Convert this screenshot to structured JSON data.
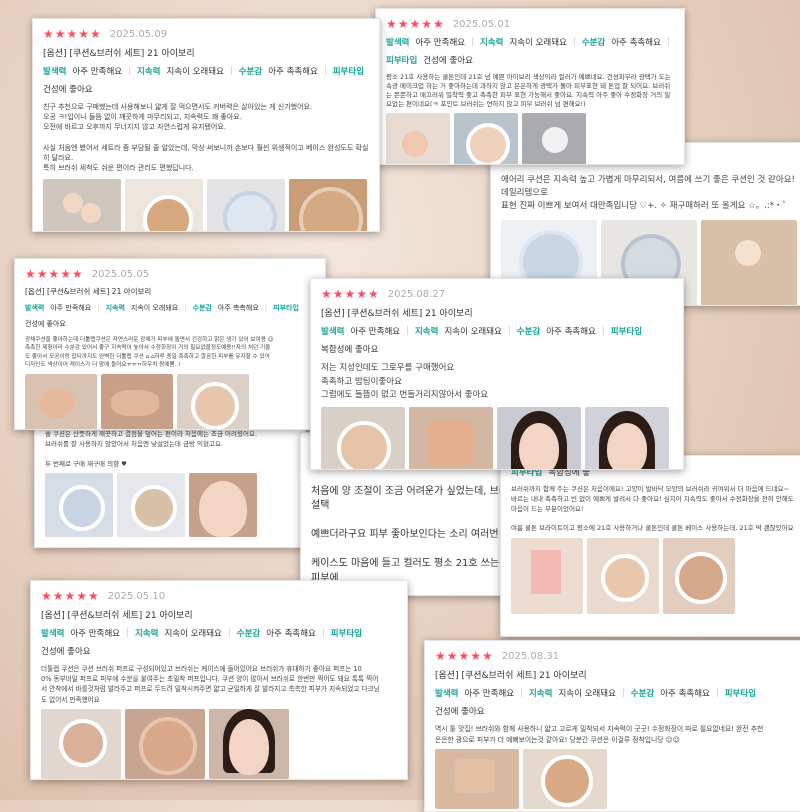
{
  "colors": {
    "star": "#ff4d5e",
    "attr_label": "#1aa39a",
    "text": "#444444",
    "date": "#aaaaaa"
  },
  "rating_stars": "★★★★★",
  "cards": {
    "c1": {
      "date": "2025.05.09",
      "option": "[옵션] [쿠션&브러쉬 세트] 21 아이보리",
      "attrs": [
        {
          "k": "발색력",
          "v": "아주 만족해요"
        },
        {
          "k": "지속력",
          "v": "지속이 오래돼요"
        },
        {
          "k": "수분감",
          "v": "아주 촉촉해요"
        },
        {
          "k": "피부타입",
          "v": "건성에 좋아요"
        }
      ],
      "body": "친구 추천으로 구매했는데 사용해보니 얇게 잘 먹으면서도 커버력은 살아있는 게 신기했어요.\n오공 ㅋ!입이나 들뜸 없이 깨끗하게 마무리되고, 지속력도 꽤 좋아요.\n오전에 바르고 오후까지 무너지지 않고 자연스럽게 유지됐어요.\n\n사실 처음엔 봤어서 세트라 좀 부담될 줄 알았는데, 막상 써보니까 손보다 훨씬 위생적이고 베이스 완성도도 확실히 달라요.\n특히 브러쉬 세척도 쉬운 편이라 관리도 편했답니다."
    },
    "c2": {
      "date": "2025.05.01",
      "attrs": [
        {
          "k": "발색력",
          "v": "아주 만족해요"
        },
        {
          "k": "지속력",
          "v": "지속이 오래돼요"
        },
        {
          "k": "수분감",
          "v": "아주 촉촉해요"
        },
        {
          "k": "피부타입",
          "v": "건성에 좋아요"
        }
      ],
      "body": "평소 21호 사용하는 쿨톤인데 21호 넘 예쁜 아이보리 색상이라 컬러가 예쁘네요. 건성피부라 광택가 도는 속광 메이크업 하는 거 좋아하는데 과하지 않고 은은하게 광택가 돌아 피부표현 돼 톤업 잘 되어요. 브러쉬는 쫀쫀하고 매끄러워 밀착력 좋고 촉촉한 피부 표현 가능해서 좋아요. 지속력 아주 좋아 수정화장 거의 필요없는 편이네요(ㅋ 포인트 브러쉬는 연하지 않고 피부 브러쉬 넘 편해요!)"
    },
    "c3": {
      "attr_a": "아주 촉촉해요",
      "attr_b_k": "피부타입",
      "attr_b_v": "지성에 좋",
      "body": "에어리 쿠션은 지속력 높고 가볍게 마무리되서, 여름에 쓰기 좋은 쿠션인 것 같아요! 데일리템으로\n표현 진짜 이쁘게 보여서 대만족입니당 ♡+. ✧ 재구매하러 또 올게요 ☆。.:*・゜"
    },
    "c4": {
      "date": "2025.05.05",
      "option": "[옵션] [쿠션&브러쉬 세트] 21 아이보리",
      "attrs": [
        {
          "k": "발색력",
          "v": "아주 만족해요"
        },
        {
          "k": "지속력",
          "v": "지속이 오래돼요"
        },
        {
          "k": "수분감",
          "v": "아주 촉촉해요"
        },
        {
          "k": "피부타입",
          "v": "건성에 좋아요"
        }
      ],
      "body": "광채쿠션을 좋아하는데 더툴랩쿠션은 자연스러운 광채가 피부에 돌면서 건강하고 맑은 생기 있어 보여용 ☺\n촉촉한 제형이라 수분감 있어서 좋구 지속력이 높아서 수정화장이 거의 필요없을정도예용!!자의 처던 기울\n도 좋아서 모공이랑 잡티까지도 완벽한 더툴랩 쿠션 ⌂ ⌂하루 종일 촉촉하고 깔끔한 피부를 유지할 수 있어\n디자인도 색상이어 케이스가 더 맘에 들어요ㅠㅠㅠ하우치 짱예쁨..!"
    },
    "c5": {
      "date": "2025.08.27",
      "option": "[옵션] [쿠션&브러쉬 세트] 21 아이보리",
      "attrs": [
        {
          "k": "발색력",
          "v": "아주 만족해요"
        },
        {
          "k": "지속력",
          "v": "지속이 오래돼요"
        },
        {
          "k": "수분감",
          "v": "아주 촉촉해요"
        },
        {
          "k": "피부타입",
          "v": "복합성에 좋아요"
        }
      ],
      "body": "저는 지성인데도 그로우를 구매했어요\n촉촉하고 밤팅이좋아요\n그럼에도 들뜸이 없고 번들거리지않아서 좋아요"
    },
    "c6": {
      "body": "쓸 쿠션은 산뜻하게 깨끗하고 결점을 덮어는 편이라 처음에는 조금 어려웠어요.\n브러쉬를 잘 사용하지 않았어서 처음엔 낯설었는데 금방 익혔고요.\n\n두 번째로 구매 재구매 의향 ♥"
    },
    "c7": {
      "line1": "편:",
      "line2": "처음에 양 조절이 조금 어려운가 싶었는데, 브러쉬 설택",
      "line3": "예쁘더라구요 피부 좋아보인다는 소리 여러번 들음",
      "line4": "케이스도 마음에 들고 컬러도 평소 21호 쓰는 웜톤 피부에"
    },
    "c8": {
      "attr_k": "피부타입",
      "attr_v": "복합성에 좋",
      "body": "브러쉬까지 함께 주는 쿠션은 처음이에요! 고양이 발바닥 모양의 브러쉬라 귀여워서 더 마음에 드네요~\n바르는 내내 촉촉하고 빈 없이 예쁘게 발려서 다 좋아요! 심지어 지속력도 좋아서 수정화장을 전혀 안해도\n마음이 드는 부분이었어요!\n\n여름 쿨톤 브라이트이고 평소에 21호 사용하거나 쿨톤인데 쿨톤 베이스 사용하는데, 21호 딱 괜찮았어요"
    },
    "c9": {
      "date": "2025.05.10",
      "option": "[옵션] [쿠션&브러쉬 세트] 21 아이보리",
      "attrs": [
        {
          "k": "발색력",
          "v": "아주 만족해요"
        },
        {
          "k": "지속력",
          "v": "지속이 오래돼요"
        },
        {
          "k": "수분감",
          "v": "아주 촉촉해요"
        },
        {
          "k": "피부타입",
          "v": "건성에 좋아요"
        }
      ],
      "body": "더툴랩 쿠션은 쿠션 브러쉬 퍼프로 구성되어있고 브러쉬는 케이스에 들어있어요 브러쉬가 휴대하기 좋아요 퍼프는 10\n0% 동부비밀 퍼프로 피부에 수분을 붙여주는 초밀착 퍼프입니다. 쿠션 양이 많아서 브러쉬로 한번만 찍어도 돼요 톡톡 찍어\n서 안착에서 바를것처럼 발라주고 퍼프로 두드려 밀착시켜주면 얇고 균일하게 잘 발라지고 촉촉한 피부가 지속되었고 다크닝\n도 없어서 만족했어요"
    },
    "c10": {
      "date": "2025.08.31",
      "option": "[옵션] [쿠션&브러쉬 세트] 21 아이보리",
      "attrs": [
        {
          "k": "발색력",
          "v": "아주 만족해요"
        },
        {
          "k": "지속력",
          "v": "지속이 오래돼요"
        },
        {
          "k": "수분감",
          "v": "아주 촉촉해요"
        },
        {
          "k": "피부타입",
          "v": "건성에 좋아요"
        }
      ],
      "body": "역시 툴 맛집! 브러쉬와 함께 사용하니 얇고 고르게 밀착되서 지속력이 굿굿! 수정화장이 따로 필요없네요! 완전 추천\n은은한 광으로 피부가 더 예뻐보이는것 같아요! 당분간 쿠션은 이걸루 정착입니당 ☺☺"
    }
  }
}
